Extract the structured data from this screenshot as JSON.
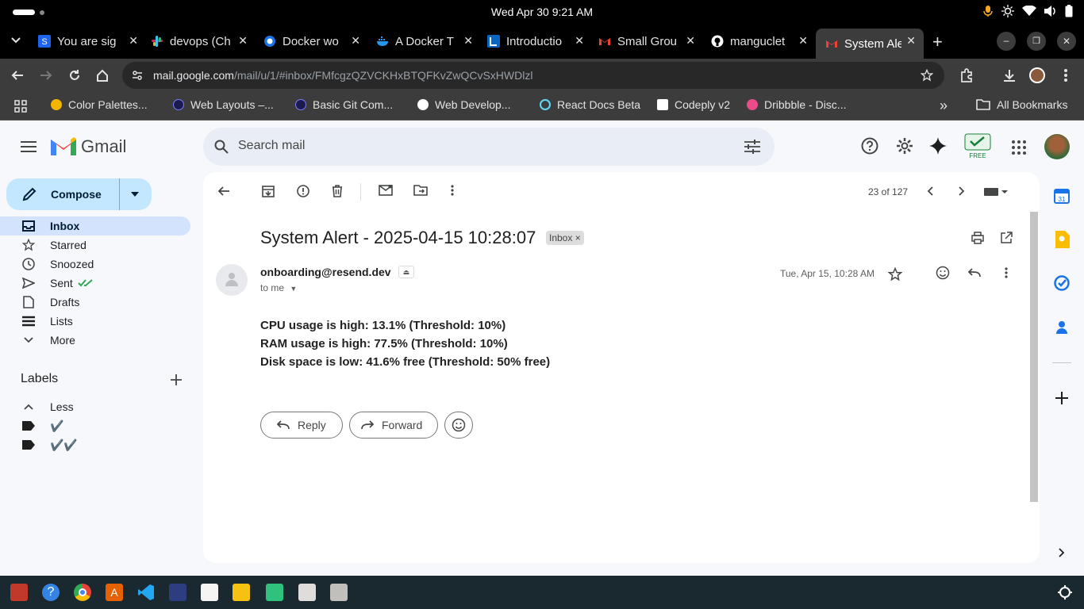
{
  "system": {
    "datetime": "Wed Apr 30   9:21 AM"
  },
  "tabs": [
    {
      "title": "You are sig",
      "favicon": "docker-hub-icon"
    },
    {
      "title": "devops (Ch",
      "favicon": "slack-icon"
    },
    {
      "title": "Docker wo",
      "favicon": "chrome-docs-icon"
    },
    {
      "title": "A Docker T",
      "favicon": "docker-icon"
    },
    {
      "title": "Introductio",
      "favicon": "learning-icon"
    },
    {
      "title": "Small Grou",
      "favicon": "gmail-icon"
    },
    {
      "title": "manguclet",
      "favicon": "github-icon"
    },
    {
      "title": "System Ale",
      "favicon": "gmail-icon",
      "active": true
    }
  ],
  "browser": {
    "url_host": "mail.google.com",
    "url_path": "/mail/u/1/#inbox/FMfcgzQZVCKHxBTQFKvZwQCvSxHWDlzl"
  },
  "bookmarks": [
    {
      "label": "Color Palettes..."
    },
    {
      "label": "Web Layouts –..."
    },
    {
      "label": "Basic Git Com..."
    },
    {
      "label": "Web Develop..."
    },
    {
      "label": "React Docs Beta"
    },
    {
      "label": "Codeply v2"
    },
    {
      "label": "Dribbble - Disc..."
    }
  ],
  "all_bookmarks": "All Bookmarks",
  "gmail": {
    "brand": "Gmail",
    "search_placeholder": "Search mail",
    "free_badge": "FREE",
    "compose": "Compose",
    "nav": [
      {
        "label": "Inbox",
        "icon": "inbox-icon",
        "active": true
      },
      {
        "label": "Starred",
        "icon": "star-icon"
      },
      {
        "label": "Snoozed",
        "icon": "clock-icon"
      },
      {
        "label": "Sent",
        "icon": "send-icon"
      },
      {
        "label": "Drafts",
        "icon": "draft-icon"
      },
      {
        "label": "Lists",
        "icon": "list-icon"
      },
      {
        "label": "More",
        "icon": "chevron-down-icon"
      }
    ],
    "labels_heading": "Labels",
    "labels": [
      {
        "label": "Less",
        "icon": "chevron-up-icon"
      },
      {
        "label": "✔️",
        "icon": "label-icon"
      },
      {
        "label": "✔️✔️",
        "icon": "label-icon"
      }
    ],
    "pagination": "23 of 127",
    "message": {
      "subject": "System Alert - 2025-04-15 10:28:07",
      "chip": "Inbox",
      "sender": "onboarding@resend.dev",
      "to": "to me",
      "date": "Tue, Apr 15, 10:28 AM",
      "lines": [
        "CPU usage is high: 13.1% (Threshold: 10%)",
        "RAM usage is high: 77.5% (Threshold: 10%)",
        "Disk space is low: 41.6% free (Threshold: 50% free)"
      ],
      "reply": "Reply",
      "forward": "Forward"
    }
  }
}
